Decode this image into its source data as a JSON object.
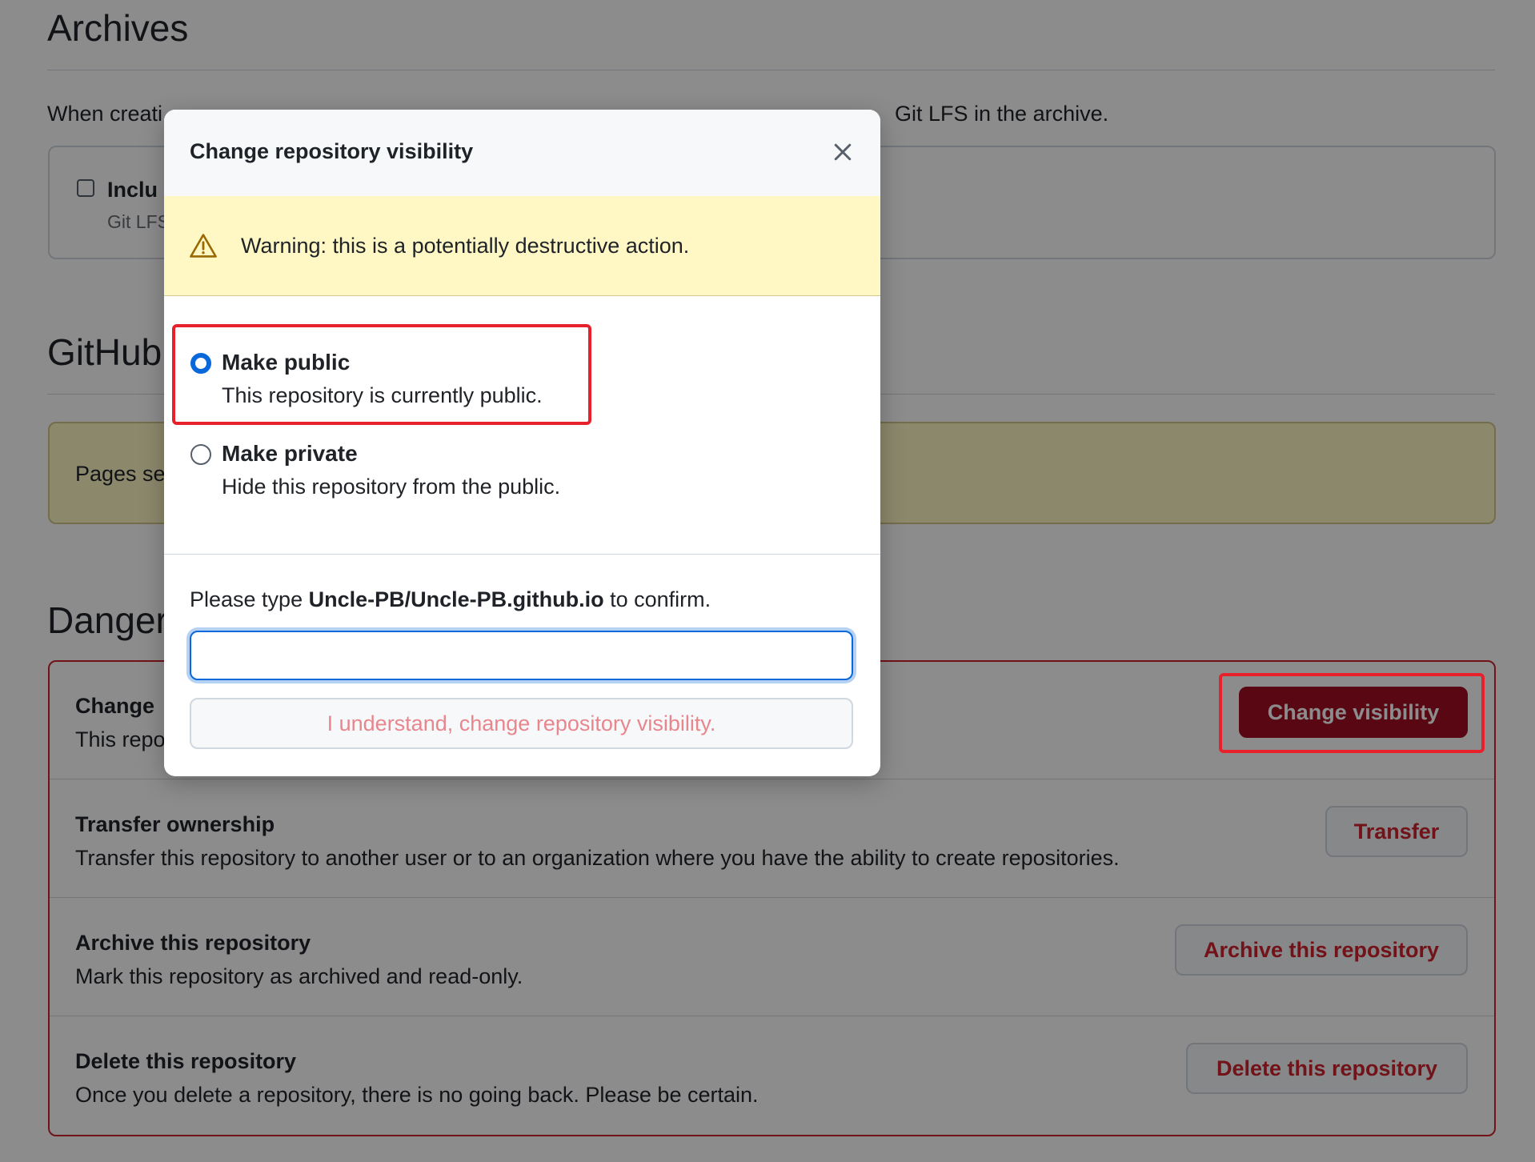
{
  "archives": {
    "title": "Archives",
    "description_left": "When creati",
    "description_right": "Git LFS in the archive.",
    "option_label": "Inclu",
    "option_sub": "Git LFS"
  },
  "pages": {
    "title": "GitHub",
    "notice": "Pages se"
  },
  "danger_zone": {
    "title": "Danger",
    "items": [
      {
        "title": "Change",
        "desc": "This repo",
        "button": "Change visibility"
      },
      {
        "title": "Transfer ownership",
        "desc": "Transfer this repository to another user or to an organization where you have the ability to create repositories.",
        "button": "Transfer"
      },
      {
        "title": "Archive this repository",
        "desc": "Mark this repository as archived and read-only.",
        "button": "Archive this repository"
      },
      {
        "title": "Delete this repository",
        "desc": "Once you delete a repository, there is no going back. Please be certain.",
        "button": "Delete this repository"
      }
    ]
  },
  "modal": {
    "title": "Change repository visibility",
    "warning": "Warning: this is a potentially destructive action.",
    "options": [
      {
        "title": "Make public",
        "desc": "This repository is currently public.",
        "checked": true
      },
      {
        "title": "Make private",
        "desc": "Hide this repository from the public.",
        "checked": false
      }
    ],
    "confirm_prefix": "Please type ",
    "confirm_repo": "Uncle-PB/Uncle-PB.github.io",
    "confirm_suffix": " to confirm.",
    "input_value": "",
    "confirm_button": "I understand, change repository visibility."
  },
  "colors": {
    "danger": "#cf222e",
    "primary_danger_bg": "#a40e26",
    "warning_bg": "#fff8c5",
    "accent": "#0969da",
    "highlight": "#e8202a"
  },
  "icons": {
    "close": "close-icon",
    "warning": "warning-icon"
  }
}
